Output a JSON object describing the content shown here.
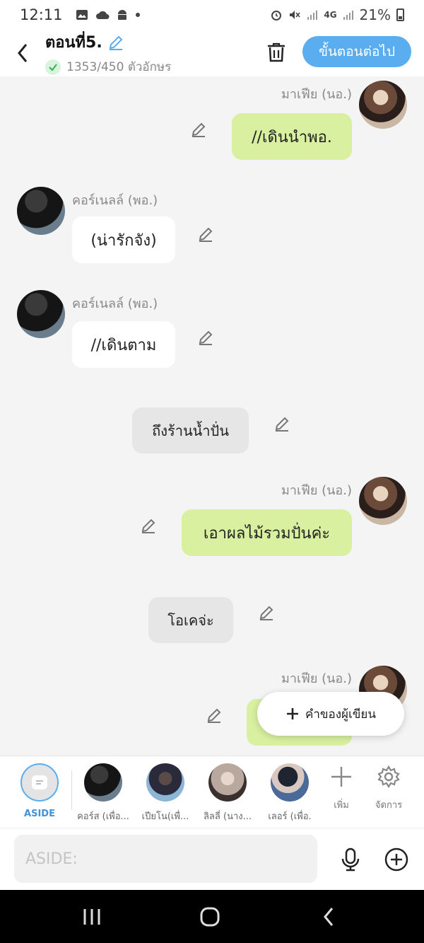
{
  "status": {
    "time": "12:11",
    "signal_label": "4G",
    "battery": "21%"
  },
  "header": {
    "title": "ตอนที่5.",
    "char_count": "1353/450 ตัวอักษร",
    "next_label": "ขั้นตอนต่อไป"
  },
  "messages": [
    {
      "speaker": "มาเฟีย (นอ.)",
      "text": "//เดินนำพอ."
    },
    {
      "speaker": "คอร์เนลล์ (พอ.)",
      "text": "(น่ารักจัง)"
    },
    {
      "speaker": "คอร์เนลล์ (พอ.)",
      "text": "//เดินตาม"
    },
    {
      "speaker": "",
      "text": "ถึงร้านน้ำปั่น"
    },
    {
      "speaker": "มาเฟีย (นอ.)",
      "text": "เอาผลไม้รวมปั่นค่ะ"
    },
    {
      "speaker": "",
      "text": "โอเคจ่ะ"
    },
    {
      "speaker": "มาเฟีย (นอ.)",
      "text": ""
    }
  ],
  "fab": {
    "label": "คำของผู้เขียน"
  },
  "characters": {
    "aside_label": "ASIDE",
    "items": [
      {
        "label": "คอร์ส (เพื่อ..."
      },
      {
        "label": "เปียโน(เพื่..."
      },
      {
        "label": "ลิลลี่ (นาง..."
      },
      {
        "label": "เลอร์ (เพื่อ."
      }
    ],
    "add_label": "เพิ่ม",
    "manage_label": "จัดการ"
  },
  "input": {
    "placeholder": "ASIDE:"
  },
  "colors": {
    "accent": "#5aaef0",
    "bubble_green": "#d8f0a0",
    "background": "#f4f4f5"
  }
}
